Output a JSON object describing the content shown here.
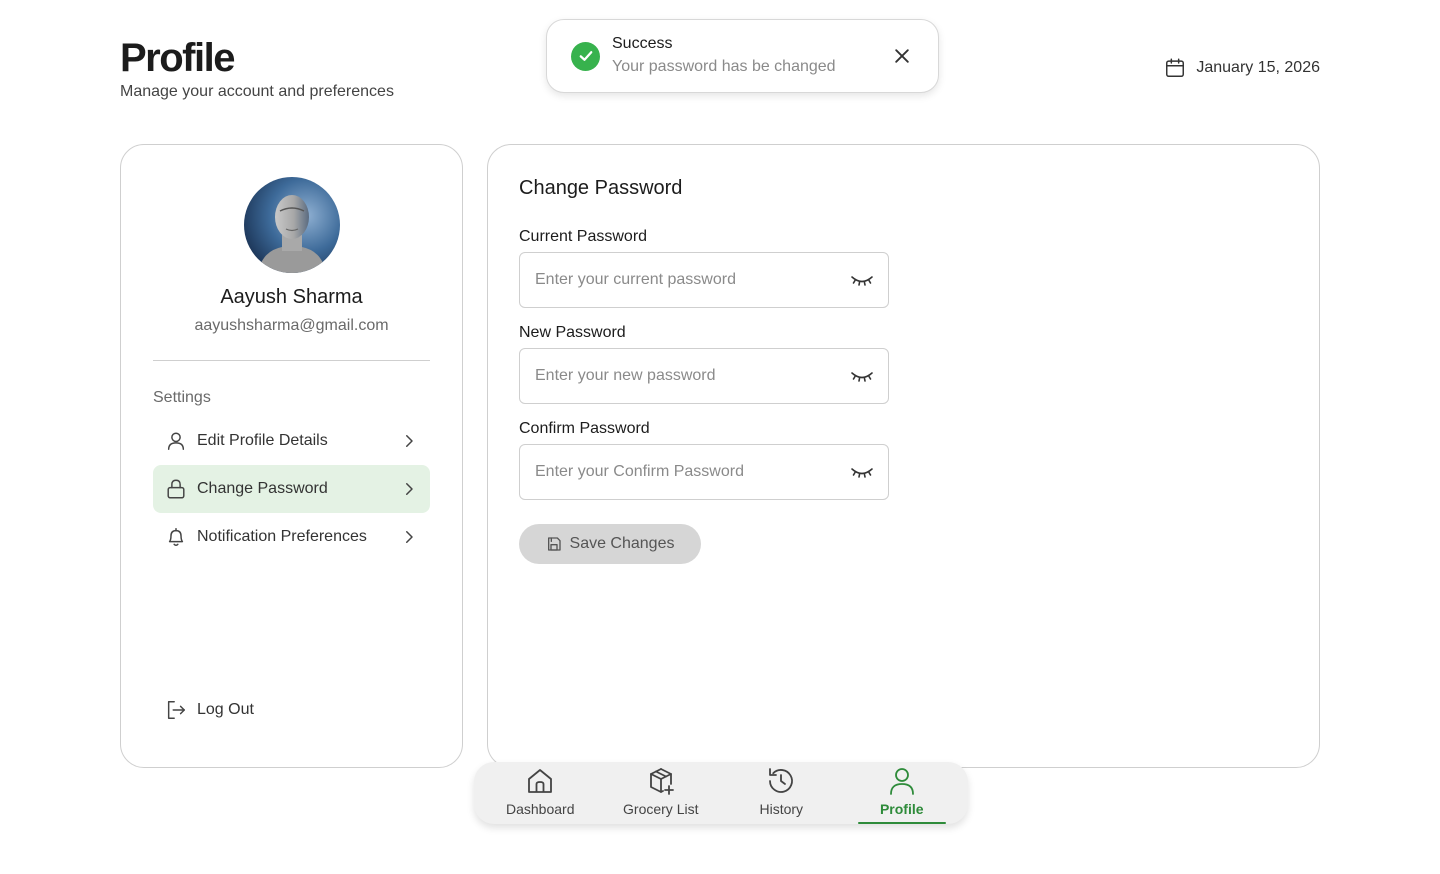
{
  "header": {
    "title": "Profile",
    "subtitle": "Manage your account and preferences",
    "date": "January 15, 2026",
    "date_icon": "calendar-icon"
  },
  "toast": {
    "title": "Success",
    "message": "Your password has be changed",
    "icon": "check-circle-icon",
    "close_icon": "close-icon",
    "color": "#37b24d"
  },
  "profile": {
    "name": "Aayush Sharma",
    "email": "aayushsharma@gmail.com",
    "avatar_icon": "avatar"
  },
  "sidebar": {
    "settings_label": "Settings",
    "items": [
      {
        "label": "Edit Profile Details",
        "icon": "user-icon",
        "active": false
      },
      {
        "label": "Change Password",
        "icon": "lock-icon",
        "active": true
      },
      {
        "label": "Notification Preferences",
        "icon": "bell-icon",
        "active": false
      }
    ],
    "logout_label": "Log Out",
    "active_bg": "#e4f2e4"
  },
  "change_password": {
    "title": "Change Password",
    "fields": [
      {
        "label": "Current Password",
        "placeholder": "Enter your current password"
      },
      {
        "label": "New Password",
        "placeholder": "Enter your new password"
      },
      {
        "label": "Confirm Password",
        "placeholder": "Enter your Confirm Password"
      }
    ],
    "save_label": "Save Changes"
  },
  "bottom_nav": {
    "items": [
      {
        "label": "Dashboard",
        "icon": "home-icon",
        "active": false
      },
      {
        "label": "Grocery List",
        "icon": "package-plus-icon",
        "active": false
      },
      {
        "label": "History",
        "icon": "history-icon",
        "active": false
      },
      {
        "label": "Profile",
        "icon": "user-icon",
        "active": true
      }
    ],
    "active_color": "#2e8b3a"
  }
}
